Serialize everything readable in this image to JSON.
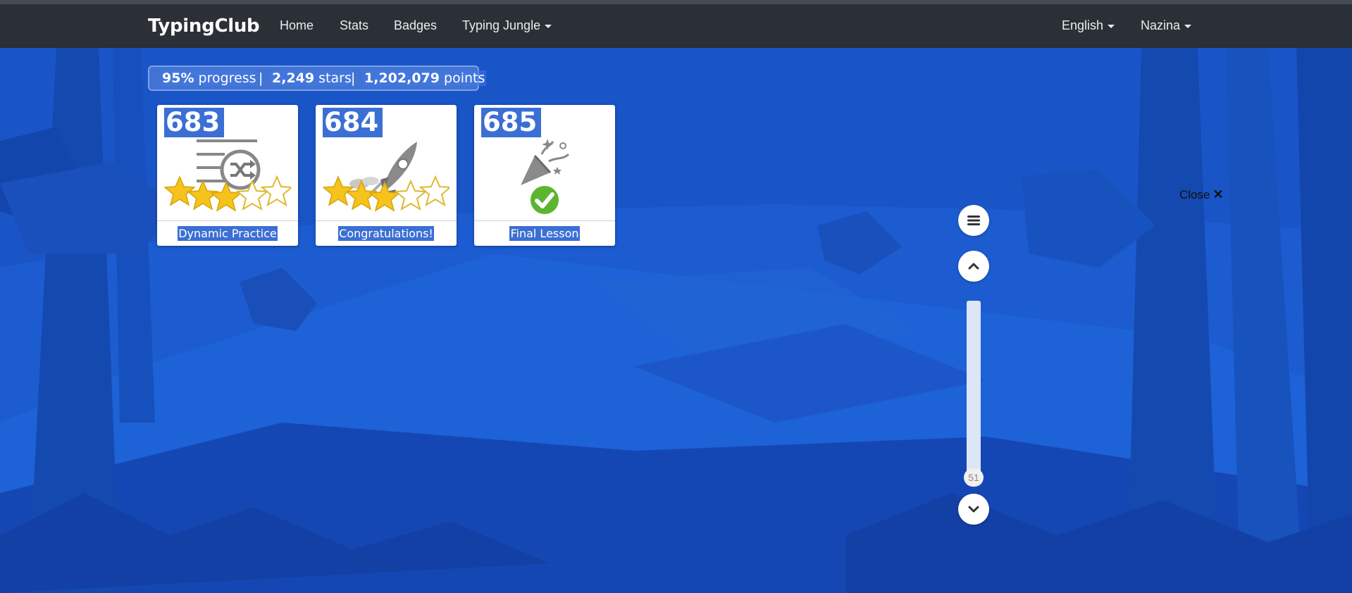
{
  "navbar": {
    "brand": "TypingClub",
    "links": [
      {
        "label": "Home"
      },
      {
        "label": "Stats"
      },
      {
        "label": "Badges"
      },
      {
        "label": "Typing Jungle"
      }
    ],
    "right_menus": [
      {
        "label": "English"
      },
      {
        "label": "Nazina"
      }
    ]
  },
  "stats": {
    "progress_value": "95%",
    "progress_label": "progress",
    "stars_value": "2,249",
    "stars_label": "stars",
    "points_value": "1,202,079",
    "points_label": "points",
    "separator": "|"
  },
  "lessons": [
    {
      "number": "683",
      "label": "Dynamic Practice",
      "icon": "shuffle-list-icon",
      "stars_earned": 3,
      "stars_total": 5
    },
    {
      "number": "684",
      "label": "Congratulations!",
      "icon": "rocket-icon",
      "stars_earned": 3,
      "stars_total": 5
    },
    {
      "number": "685",
      "label": "Final Lesson",
      "icon": "party-popper-icon",
      "completed": true
    }
  ],
  "close": {
    "label": "Close",
    "icon": "close-x-icon"
  },
  "side_controls": {
    "menu_icon": "hamburger-menu-icon",
    "up_icon": "chevron-up-icon",
    "down_icon": "chevron-down-icon",
    "scroll_position_label": "51"
  },
  "colors": {
    "background": "#1a56c9",
    "navbar": "#2b3036",
    "highlight": "#3b6fd4",
    "star_gold": "#f6c21c"
  }
}
